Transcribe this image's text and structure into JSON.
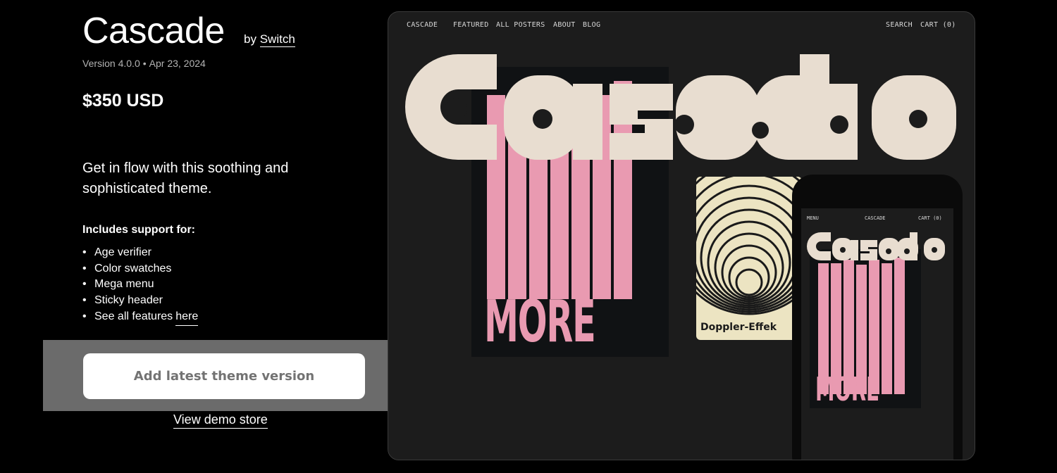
{
  "product": {
    "title": "Cascade",
    "by_prefix": "by",
    "author": "Switch",
    "version": "Version 4.0.0",
    "date": "Apr 23, 2024",
    "price": "$350 USD",
    "description": "Get in flow with this soothing and sophisticated theme.",
    "includes_title": "Includes support for:",
    "features": [
      "Age verifier",
      "Color swatches",
      "Mega menu",
      "Sticky header"
    ],
    "see_all_prefix": "See all features",
    "see_all_link": "here",
    "add_button": "Add latest theme version",
    "demo_link": "View demo store"
  },
  "preview": {
    "nav": {
      "logo": "CASCADE",
      "items": [
        "FEATURED",
        "ALL POSTERS",
        "ABOUT",
        "BLOG"
      ],
      "search": "SEARCH",
      "cart": "CART (0)"
    },
    "hero_word": "Cascade",
    "poster_word": "MORE",
    "small_poster_title": "Doppler-Effek",
    "mobile_nav": {
      "menu": "MENU",
      "logo": "CASCADE",
      "cart": "CART (0)"
    },
    "colors": {
      "cream": "#e8ddd0",
      "pink": "#e99ab1",
      "bg": "#1c1c1c"
    }
  }
}
